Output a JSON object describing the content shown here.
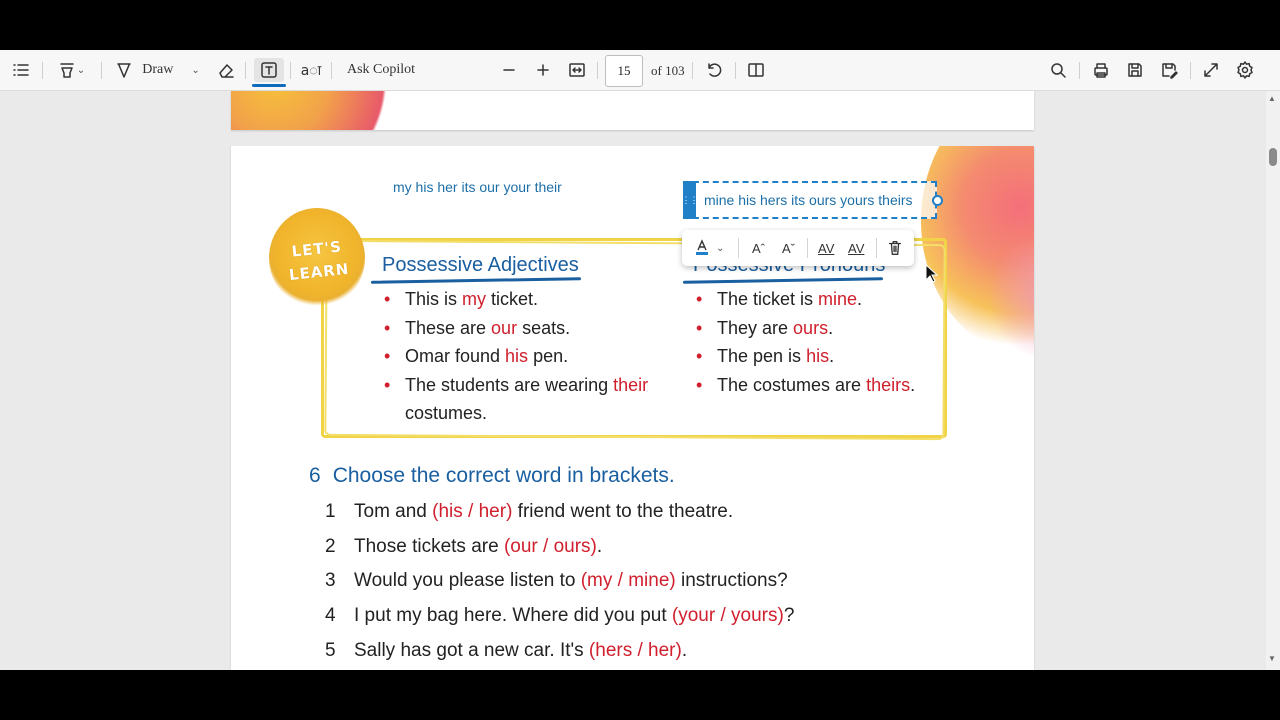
{
  "toolbar": {
    "draw_label": "Draw",
    "ask_copilot_label": "Ask Copilot",
    "page_number": "15",
    "page_total": "of 103"
  },
  "page": {
    "annotation_text_1": "my his her its our your their",
    "annotation_text_2": "mine his hers its ours yours theirs",
    "lets_learn_line1": "LET'S",
    "lets_learn_line2": "LEARN",
    "adjectives": {
      "title": "Possessive Adjectives",
      "items": [
        {
          "pre": "This is ",
          "hl": "my",
          "post": " ticket."
        },
        {
          "pre": "These are ",
          "hl": "our",
          "post": " seats."
        },
        {
          "pre": "Omar found ",
          "hl": "his",
          "post": " pen."
        },
        {
          "pre": "The students are wearing ",
          "hl": "their",
          "post": " costumes."
        }
      ]
    },
    "pronouns": {
      "title": "Possessive Pronouns",
      "items": [
        {
          "pre": "The ticket is ",
          "hl": "mine",
          "post": "."
        },
        {
          "pre": "They are ",
          "hl": "ours",
          "post": "."
        },
        {
          "pre": "The pen is ",
          "hl": "his",
          "post": "."
        },
        {
          "pre": "The costumes are ",
          "hl": "theirs",
          "post": "."
        }
      ]
    },
    "exercise": {
      "number": "6",
      "heading": "Choose the correct word in brackets.",
      "items": [
        {
          "n": "1",
          "pre": "Tom and ",
          "hl": "(his / her)",
          "post": " friend went to the theatre."
        },
        {
          "n": "2",
          "pre": "Those tickets are ",
          "hl": "(our / ours)",
          "post": "."
        },
        {
          "n": "3",
          "pre": "Would you please listen to ",
          "hl": "(my / mine)",
          "post": " instructions?"
        },
        {
          "n": "4",
          "pre": "I put my bag here. Where did you put ",
          "hl": "(your / yours)",
          "post": "?"
        },
        {
          "n": "5",
          "pre": "Sally has got a new car. It's ",
          "hl": "(hers / her)",
          "post": "."
        }
      ]
    }
  },
  "colors": {
    "accent": "#0f6cbd",
    "heading_blue": "#1a5fa0",
    "highlight_red": "#d0202e",
    "frame_yellow": "#f0d346"
  }
}
